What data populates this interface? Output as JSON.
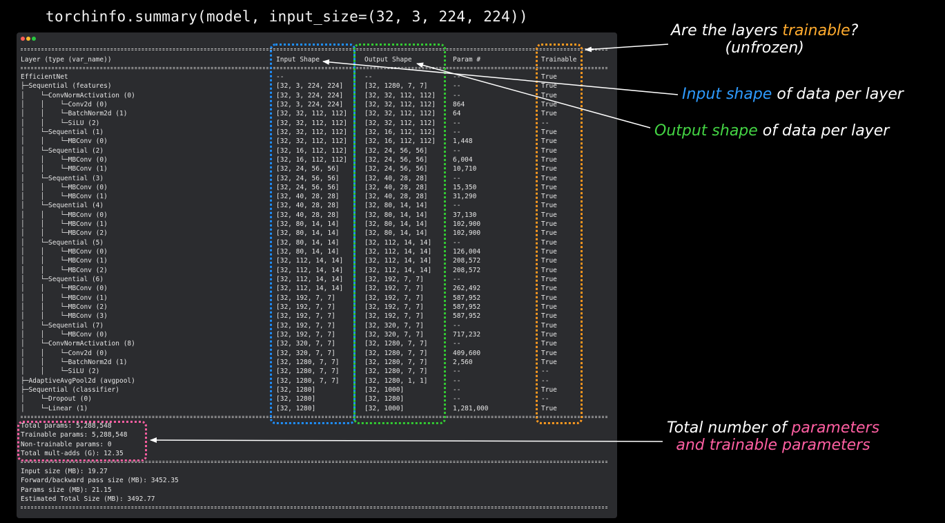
{
  "title": "torchinfo.summary(model, input_size=(32, 3, 224, 224))",
  "colors": {
    "input_box": "#1e8fff",
    "output_box": "#33cc33",
    "trainable_box": "#ff9a1f",
    "totals_box": "#ff5fa2",
    "annot_trainable": "#ffab2e",
    "annot_input": "#2e9bff",
    "annot_output": "#44d444",
    "annot_params": "#ff5fa2"
  },
  "table": {
    "headers": [
      "Layer (type (var_name))",
      "Input Shape",
      "Output Shape",
      "Param #",
      "Trainable"
    ],
    "rows": [
      [
        "EfficientNet",
        "--",
        "--",
        "--",
        "True"
      ],
      [
        "├─Sequential (features)",
        "[32, 3, 224, 224]",
        "[32, 1280, 7, 7]",
        "--",
        "True"
      ],
      [
        "│    └─ConvNormActivation (0)",
        "[32, 3, 224, 224]",
        "[32, 32, 112, 112]",
        "--",
        "True"
      ],
      [
        "│    │    └─Conv2d (0)",
        "[32, 3, 224, 224]",
        "[32, 32, 112, 112]",
        "864",
        "True"
      ],
      [
        "│    │    └─BatchNorm2d (1)",
        "[32, 32, 112, 112]",
        "[32, 32, 112, 112]",
        "64",
        "True"
      ],
      [
        "│    │    └─SiLU (2)",
        "[32, 32, 112, 112]",
        "[32, 32, 112, 112]",
        "--",
        "--"
      ],
      [
        "│    └─Sequential (1)",
        "[32, 32, 112, 112]",
        "[32, 16, 112, 112]",
        "--",
        "True"
      ],
      [
        "│    │    └─MBConv (0)",
        "[32, 32, 112, 112]",
        "[32, 16, 112, 112]",
        "1,448",
        "True"
      ],
      [
        "│    └─Sequential (2)",
        "[32, 16, 112, 112]",
        "[32, 24, 56, 56]",
        "--",
        "True"
      ],
      [
        "│    │    └─MBConv (0)",
        "[32, 16, 112, 112]",
        "[32, 24, 56, 56]",
        "6,004",
        "True"
      ],
      [
        "│    │    └─MBConv (1)",
        "[32, 24, 56, 56]",
        "[32, 24, 56, 56]",
        "10,710",
        "True"
      ],
      [
        "│    └─Sequential (3)",
        "[32, 24, 56, 56]",
        "[32, 40, 28, 28]",
        "--",
        "True"
      ],
      [
        "│    │    └─MBConv (0)",
        "[32, 24, 56, 56]",
        "[32, 40, 28, 28]",
        "15,350",
        "True"
      ],
      [
        "│    │    └─MBConv (1)",
        "[32, 40, 28, 28]",
        "[32, 40, 28, 28]",
        "31,290",
        "True"
      ],
      [
        "│    └─Sequential (4)",
        "[32, 40, 28, 28]",
        "[32, 80, 14, 14]",
        "--",
        "True"
      ],
      [
        "│    │    └─MBConv (0)",
        "[32, 40, 28, 28]",
        "[32, 80, 14, 14]",
        "37,130",
        "True"
      ],
      [
        "│    │    └─MBConv (1)",
        "[32, 80, 14, 14]",
        "[32, 80, 14, 14]",
        "102,900",
        "True"
      ],
      [
        "│    │    └─MBConv (2)",
        "[32, 80, 14, 14]",
        "[32, 80, 14, 14]",
        "102,900",
        "True"
      ],
      [
        "│    └─Sequential (5)",
        "[32, 80, 14, 14]",
        "[32, 112, 14, 14]",
        "--",
        "True"
      ],
      [
        "│    │    └─MBConv (0)",
        "[32, 80, 14, 14]",
        "[32, 112, 14, 14]",
        "126,004",
        "True"
      ],
      [
        "│    │    └─MBConv (1)",
        "[32, 112, 14, 14]",
        "[32, 112, 14, 14]",
        "208,572",
        "True"
      ],
      [
        "│    │    └─MBConv (2)",
        "[32, 112, 14, 14]",
        "[32, 112, 14, 14]",
        "208,572",
        "True"
      ],
      [
        "│    └─Sequential (6)",
        "[32, 112, 14, 14]",
        "[32, 192, 7, 7]",
        "--",
        "True"
      ],
      [
        "│    │    └─MBConv (0)",
        "[32, 112, 14, 14]",
        "[32, 192, 7, 7]",
        "262,492",
        "True"
      ],
      [
        "│    │    └─MBConv (1)",
        "[32, 192, 7, 7]",
        "[32, 192, 7, 7]",
        "587,952",
        "True"
      ],
      [
        "│    │    └─MBConv (2)",
        "[32, 192, 7, 7]",
        "[32, 192, 7, 7]",
        "587,952",
        "True"
      ],
      [
        "│    │    └─MBConv (3)",
        "[32, 192, 7, 7]",
        "[32, 192, 7, 7]",
        "587,952",
        "True"
      ],
      [
        "│    └─Sequential (7)",
        "[32, 192, 7, 7]",
        "[32, 320, 7, 7]",
        "--",
        "True"
      ],
      [
        "│    │    └─MBConv (0)",
        "[32, 192, 7, 7]",
        "[32, 320, 7, 7]",
        "717,232",
        "True"
      ],
      [
        "│    └─ConvNormActivation (8)",
        "[32, 320, 7, 7]",
        "[32, 1280, 7, 7]",
        "--",
        "True"
      ],
      [
        "│    │    └─Conv2d (0)",
        "[32, 320, 7, 7]",
        "[32, 1280, 7, 7]",
        "409,600",
        "True"
      ],
      [
        "│    │    └─BatchNorm2d (1)",
        "[32, 1280, 7, 7]",
        "[32, 1280, 7, 7]",
        "2,560",
        "True"
      ],
      [
        "│    │    └─SiLU (2)",
        "[32, 1280, 7, 7]",
        "[32, 1280, 7, 7]",
        "--",
        "--"
      ],
      [
        "├─AdaptiveAvgPool2d (avgpool)",
        "[32, 1280, 7, 7]",
        "[32, 1280, 1, 1]",
        "--",
        "--"
      ],
      [
        "├─Sequential (classifier)",
        "[32, 1280]",
        "[32, 1000]",
        "--",
        "True"
      ],
      [
        "│    └─Dropout (0)",
        "[32, 1280]",
        "[32, 1280]",
        "--",
        "--"
      ],
      [
        "│    └─Linear (1)",
        "[32, 1280]",
        "[32, 1000]",
        "1,281,000",
        "True"
      ]
    ]
  },
  "totals": [
    "Total params: 5,288,548",
    "Trainable params: 5,288,548",
    "Non-trainable params: 0",
    "Total mult-adds (G): 12.35"
  ],
  "sizes": [
    "Input size (MB): 19.27",
    "Forward/backward pass size (MB): 3452.35",
    "Params size (MB): 21.15",
    "Estimated Total Size (MB): 3492.77"
  ],
  "annotations": {
    "trainable": {
      "pre": "Are the layers ",
      "hl": "trainable",
      "post": "?",
      "line2": "(unfrozen)"
    },
    "input": {
      "hl": "Input shape",
      "post": " of data per layer"
    },
    "output": {
      "hl": "Output shape",
      "post": " of data per layer"
    },
    "total": {
      "pre": "Total number of ",
      "hl1": "parameters",
      "hl2": "and trainable parameters"
    }
  }
}
